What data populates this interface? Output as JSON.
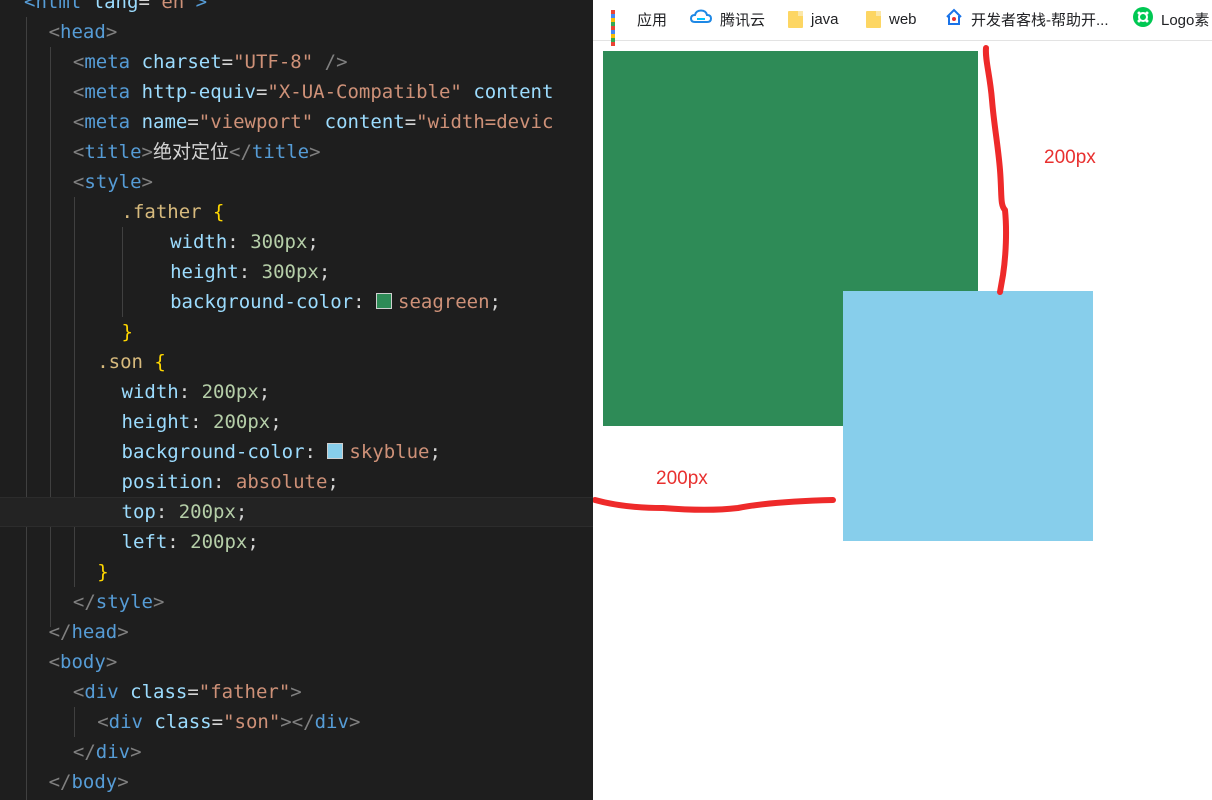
{
  "editor": {
    "lines": [
      [
        [
          "tag",
          "<"
        ],
        [
          "tag",
          "html"
        ],
        [
          "txt",
          " "
        ],
        [
          "attr",
          "lang"
        ],
        [
          "eq",
          "="
        ],
        [
          "str",
          "\"en\""
        ],
        [
          "tag",
          ">"
        ]
      ],
      [
        [
          "punc",
          "<"
        ],
        [
          "tag",
          "head"
        ],
        [
          "punc",
          ">"
        ]
      ],
      [
        [
          "punc",
          "<"
        ],
        [
          "tag",
          "meta"
        ],
        [
          "txt",
          " "
        ],
        [
          "attr",
          "charset"
        ],
        [
          "eq",
          "="
        ],
        [
          "str",
          "\"UTF-8\""
        ],
        [
          "txt",
          " "
        ],
        [
          "punc",
          "/>"
        ]
      ],
      [
        [
          "punc",
          "<"
        ],
        [
          "tag",
          "meta"
        ],
        [
          "txt",
          " "
        ],
        [
          "attr",
          "http-equiv"
        ],
        [
          "eq",
          "="
        ],
        [
          "str",
          "\"X-UA-Compatible\""
        ],
        [
          "txt",
          " "
        ],
        [
          "attr",
          "content"
        ]
      ],
      [
        [
          "punc",
          "<"
        ],
        [
          "tag",
          "meta"
        ],
        [
          "txt",
          " "
        ],
        [
          "attr",
          "name"
        ],
        [
          "eq",
          "="
        ],
        [
          "str",
          "\"viewport\""
        ],
        [
          "txt",
          " "
        ],
        [
          "attr",
          "content"
        ],
        [
          "eq",
          "="
        ],
        [
          "str",
          "\"width=devic"
        ]
      ],
      [
        [
          "punc",
          "<"
        ],
        [
          "tag",
          "title"
        ],
        [
          "punc",
          ">"
        ],
        [
          "txt",
          "绝对定位"
        ],
        [
          "punc",
          "</"
        ],
        [
          "tag",
          "title"
        ],
        [
          "punc",
          ">"
        ]
      ],
      [
        [
          "punc",
          "<"
        ],
        [
          "tag",
          "style"
        ],
        [
          "punc",
          ">"
        ]
      ],
      [
        [
          "sel",
          ".father"
        ],
        [
          "txt",
          " "
        ],
        [
          "brace",
          "{"
        ]
      ],
      [
        [
          "prop",
          "width"
        ],
        [
          "colon",
          ": "
        ],
        [
          "num",
          "300px"
        ],
        [
          "semi",
          ";"
        ]
      ],
      [
        [
          "prop",
          "height"
        ],
        [
          "colon",
          ": "
        ],
        [
          "num",
          "300px"
        ],
        [
          "semi",
          ";"
        ]
      ],
      [
        [
          "prop",
          "background-color"
        ],
        [
          "colon",
          ": "
        ],
        [
          "swatch",
          "seagreen"
        ],
        [
          "val",
          "seagreen"
        ],
        [
          "semi",
          ";"
        ]
      ],
      [
        [
          "brace",
          "}"
        ]
      ],
      [
        [
          "sel",
          ".son"
        ],
        [
          "txt",
          " "
        ],
        [
          "brace",
          "{"
        ]
      ],
      [
        [
          "prop",
          "width"
        ],
        [
          "colon",
          ": "
        ],
        [
          "num",
          "200px"
        ],
        [
          "semi",
          ";"
        ]
      ],
      [
        [
          "prop",
          "height"
        ],
        [
          "colon",
          ": "
        ],
        [
          "num",
          "200px"
        ],
        [
          "semi",
          ";"
        ]
      ],
      [
        [
          "prop",
          "background-color"
        ],
        [
          "colon",
          ": "
        ],
        [
          "swatch",
          "skyblue"
        ],
        [
          "val",
          "skyblue"
        ],
        [
          "semi",
          ";"
        ]
      ],
      [
        [
          "prop",
          "position"
        ],
        [
          "colon",
          ": "
        ],
        [
          "val",
          "absolute"
        ],
        [
          "semi",
          ";"
        ]
      ],
      [
        [
          "prop",
          "top"
        ],
        [
          "colon",
          ": "
        ],
        [
          "num",
          "200px"
        ],
        [
          "semi",
          ";"
        ]
      ],
      [
        [
          "prop",
          "left"
        ],
        [
          "colon",
          ": "
        ],
        [
          "num",
          "200px"
        ],
        [
          "semi",
          ";"
        ]
      ],
      [
        [
          "brace",
          "}"
        ]
      ],
      [
        [
          "punc",
          "</"
        ],
        [
          "tag",
          "style"
        ],
        [
          "punc",
          ">"
        ]
      ],
      [
        [
          "punc",
          "</"
        ],
        [
          "tag",
          "head"
        ],
        [
          "punc",
          ">"
        ]
      ],
      [
        [
          "punc",
          "<"
        ],
        [
          "tag",
          "body"
        ],
        [
          "punc",
          ">"
        ]
      ],
      [
        [
          "punc",
          "<"
        ],
        [
          "tag",
          "div"
        ],
        [
          "txt",
          " "
        ],
        [
          "attr",
          "class"
        ],
        [
          "eq",
          "="
        ],
        [
          "str",
          "\"father\""
        ],
        [
          "punc",
          ">"
        ]
      ],
      [
        [
          "punc",
          "<"
        ],
        [
          "tag",
          "div"
        ],
        [
          "txt",
          " "
        ],
        [
          "attr",
          "class"
        ],
        [
          "eq",
          "="
        ],
        [
          "str",
          "\"son\""
        ],
        [
          "punc",
          "></"
        ],
        [
          "tag",
          "div"
        ],
        [
          "punc",
          ">"
        ]
      ],
      [
        [
          "punc",
          "</"
        ],
        [
          "tag",
          "div"
        ],
        [
          "punc",
          ">"
        ]
      ],
      [
        [
          "punc",
          "</"
        ],
        [
          "tag",
          "body"
        ],
        [
          "punc",
          ">"
        ]
      ]
    ],
    "active_line": 17,
    "syntax_colors": {
      "tag": "#569cd6",
      "punc": "#808080",
      "attr": "#9cdcfe",
      "string": "#ce9178",
      "selector": "#d7ba7d",
      "brace": "#ffd700",
      "number": "#b5cea8",
      "background": "#1e1e1e"
    }
  },
  "bookmarks": [
    {
      "label": "应用",
      "icon": "apps-grid-icon"
    },
    {
      "label": "腾讯云",
      "icon": "tencent-cloud-icon"
    },
    {
      "label": "java",
      "icon": "folder-icon"
    },
    {
      "label": "web",
      "icon": "folder-icon"
    },
    {
      "label": "开发者客栈-帮助开...",
      "icon": "devhouse-icon"
    },
    {
      "label": "Logo素",
      "icon": "logo-site-icon"
    }
  ],
  "preview": {
    "father_color": "#2e8b57",
    "son_color": "#87ceeb",
    "annotation_vertical": "200px",
    "annotation_horizontal": "200px",
    "annotation_color": "#e8302f"
  }
}
